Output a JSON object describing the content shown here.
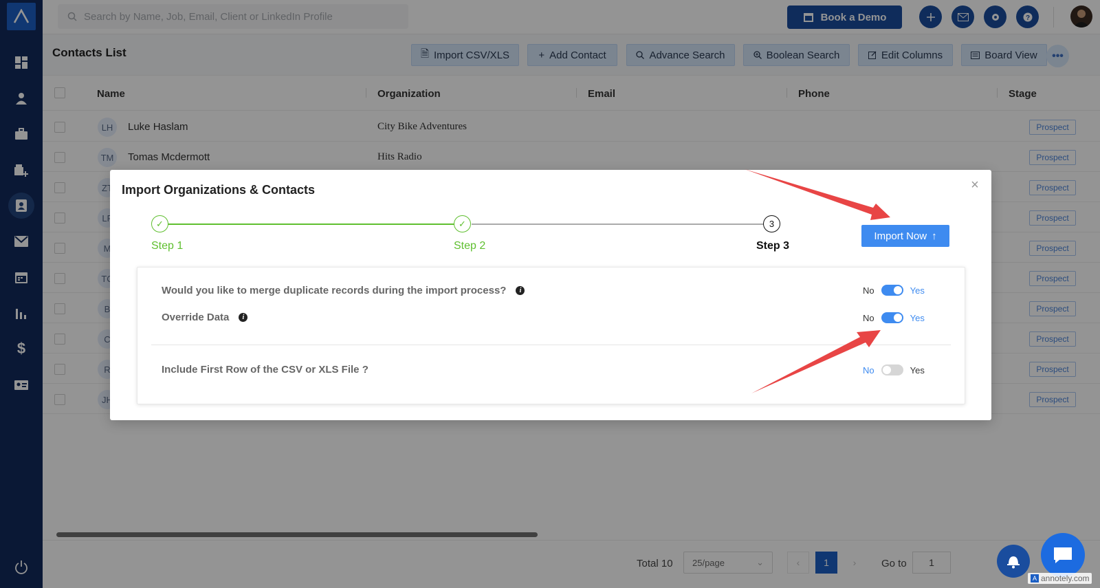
{
  "topbar": {
    "search_placeholder": "Search by Name, Job, Email, Client or LinkedIn Profile",
    "book_demo_label": "Book a Demo"
  },
  "header": {
    "title": "Contacts List",
    "buttons": [
      {
        "label": "Import CSV/XLS",
        "icon": "file-import-icon"
      },
      {
        "label": "Add Contact",
        "icon": "plus-icon"
      },
      {
        "label": "Advance Search",
        "icon": "search-icon"
      },
      {
        "label": "Boolean Search",
        "icon": "search-plus-icon"
      },
      {
        "label": "Edit Columns",
        "icon": "edit-icon"
      },
      {
        "label": "Board View",
        "icon": "board-icon"
      }
    ]
  },
  "table": {
    "columns": [
      "Name",
      "Organization",
      "Email",
      "Phone",
      "Stage"
    ],
    "rows": [
      {
        "initials": "LH",
        "name": "Luke Haslam",
        "organization": "City Bike Adventures",
        "stage": "Prospect"
      },
      {
        "initials": "TM",
        "name": "Tomas Mcdermott",
        "organization": "Hits Radio",
        "stage": "Prospect"
      },
      {
        "initials": "ZT",
        "name": "",
        "organization": "",
        "stage": "Prospect"
      },
      {
        "initials": "LF",
        "name": "",
        "organization": "",
        "stage": "Prospect"
      },
      {
        "initials": "M",
        "name": "",
        "organization": "",
        "stage": "Prospect"
      },
      {
        "initials": "TC",
        "name": "",
        "organization": "",
        "stage": "Prospect"
      },
      {
        "initials": "B",
        "name": "",
        "organization": "",
        "stage": "Prospect"
      },
      {
        "initials": "C",
        "name": "",
        "organization": "",
        "stage": "Prospect"
      },
      {
        "initials": "R",
        "name": "",
        "organization": "",
        "stage": "Prospect"
      },
      {
        "initials": "JH",
        "name": "",
        "organization": "",
        "stage": "Prospect"
      }
    ]
  },
  "footer": {
    "total": "Total 10",
    "page_size": "25/page",
    "current_page": "1",
    "goto_label": "Go to",
    "goto_value": "1"
  },
  "modal": {
    "title": "Import Organizations & Contacts",
    "steps": [
      "Step 1",
      "Step 2",
      "Step 3"
    ],
    "current_step_number": "3",
    "import_now_label": "Import Now",
    "options": [
      {
        "question": "Would you like to merge duplicate records during the import process?",
        "no": "No",
        "yes": "Yes",
        "enabled": true
      },
      {
        "question": "Override Data",
        "no": "No",
        "yes": "Yes",
        "enabled": true
      },
      {
        "question": "Include First Row of the CSV or XLS File ?",
        "no": "No",
        "yes": "Yes",
        "enabled": false
      }
    ]
  },
  "watermark": "annotely.com",
  "colors": {
    "sidebar": "#122a5c",
    "primary": "#3e8bf0",
    "step_done": "#5fbf2f",
    "arrow": "#e84545"
  }
}
